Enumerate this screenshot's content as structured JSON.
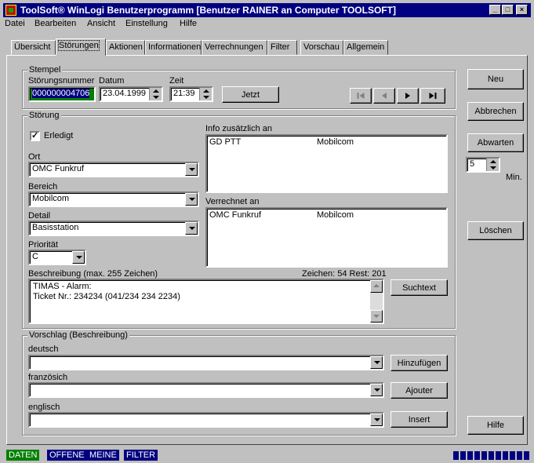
{
  "window": {
    "title": "ToolSoft® WinLogi Benutzerprogramm [Benutzer RAINER an Computer TOOLSOFT]",
    "controls": [
      "_",
      "□",
      "×"
    ]
  },
  "menu": [
    "Datei",
    "Bearbeiten",
    "Ansicht",
    "Einstellung",
    "Hilfe"
  ],
  "tabs": [
    "Übersicht",
    "Störungen",
    "Aktionen",
    "Informationen",
    "Verrechnungen",
    "Filter",
    "Vorschau",
    "Allgemein"
  ],
  "active_tab": "Störungen",
  "stempel": {
    "legend": "Stempel",
    "nummer_label": "Störungsnummer",
    "nummer_value": "000000004706",
    "datum_label": "Datum",
    "datum_value": "23.04.1999",
    "zeit_label": "Zeit",
    "zeit_value": "21:39",
    "jetzt_label": "Jetzt"
  },
  "stoerung": {
    "legend": "Störung",
    "erledigt_label": "Erledigt",
    "erledigt_checked": true,
    "erledigt_mark": "✓",
    "ort_label": "Ort",
    "ort_value": "OMC Funkruf",
    "bereich_label": "Bereich",
    "bereich_value": "Mobilcom",
    "detail_label": "Detail",
    "detail_value": "Basisstation",
    "prioritaet_label": "Priorität",
    "prioritaet_value": "C",
    "info_label": "Info zusätzlich an",
    "info_rows": [
      {
        "name": "GD PTT",
        "company": "Mobilcom"
      }
    ],
    "verrechnet_label": "Verrechnet an",
    "verrechnet_rows": [
      {
        "name": "OMC Funkruf",
        "company": "Mobilcom"
      }
    ],
    "beschreibung_label": "Beschreibung (max. 255 Zeichen)",
    "zeichen_text": "Zeichen: 54 Rest: 201",
    "beschreibung_lines": [
      "TIMAS - Alarm:",
      "Ticket Nr.: 234234  (041/234 234 2234)"
    ],
    "suchtext_label": "Suchtext"
  },
  "vorschlag": {
    "legend": "Vorschlag (Beschreibung)",
    "deutsch_label": "deutsch",
    "deutsch_button": "Hinzufügen",
    "franz_label": "französich",
    "franz_button": "Ajouter",
    "englisch_label": "englisch",
    "englisch_button": "Insert"
  },
  "side_buttons": {
    "neu": "Neu",
    "abbrechen": "Abbrechen",
    "abwarten": "Abwarten",
    "abwarten_minutes": "5",
    "min_label": "Min.",
    "loeschen": "Löschen",
    "hilfe": "Hilfe"
  },
  "statusbar": {
    "cells": [
      "DATEN",
      "OFFENE",
      "MEINE",
      "FILTER"
    ],
    "active_cell": "DATEN",
    "progress": 1.0
  }
}
